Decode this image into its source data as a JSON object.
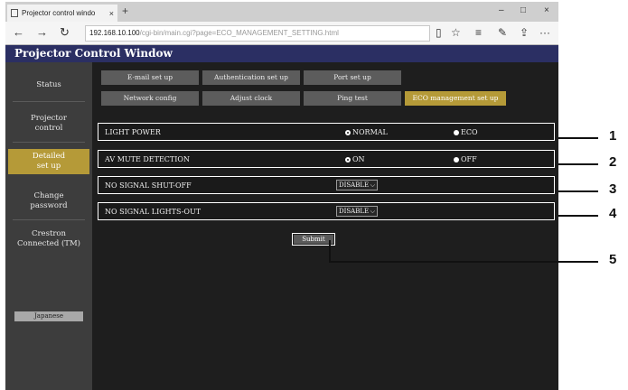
{
  "browser": {
    "tab_title": "Projector control windo",
    "tab_close": "×",
    "new_tab": "+",
    "url_host": "192.168.10.100",
    "url_path": "/cgi-bin/main.cgi?page=ECO_MANAGEMENT_SETTING.html",
    "nav_back": "←",
    "nav_forward": "→",
    "nav_refresh": "↻",
    "win_min": "–",
    "win_max": "□",
    "win_close": "×",
    "tool_reading": "▯",
    "tool_fav": "☆",
    "tool_hub": "≡",
    "tool_note": "✎",
    "tool_share": "⇪",
    "tool_more": "···"
  },
  "app": {
    "title": "Projector Control Window"
  },
  "sidebar": {
    "items": [
      {
        "label": "Status"
      },
      {
        "label": "Projector\ncontrol"
      },
      {
        "label": "Detailed\nset up"
      },
      {
        "label": "Change\npassword"
      },
      {
        "label": "Crestron\nConnected (TM)"
      }
    ],
    "language_button": "Japanese"
  },
  "tabs": {
    "row1": [
      "E-mail set up",
      "Authentication set up",
      "Port set up"
    ],
    "row2": [
      "Network config",
      "Adjust clock",
      "Ping test",
      "ECO management set up"
    ]
  },
  "settings": {
    "light_power": {
      "label": "LIGHT POWER",
      "options": [
        "NORMAL",
        "ECO"
      ]
    },
    "av_mute": {
      "label": "AV MUTE DETECTION",
      "options": [
        "ON",
        "OFF"
      ]
    },
    "no_signal_shutoff": {
      "label": "NO SIGNAL SHUT-OFF",
      "value": "DISABLE"
    },
    "no_signal_lightsout": {
      "label": "NO SIGNAL LIGHTS-OUT",
      "value": "DISABLE"
    }
  },
  "submit_label": "Submit",
  "callouts": [
    "1",
    "2",
    "3",
    "4",
    "5"
  ]
}
